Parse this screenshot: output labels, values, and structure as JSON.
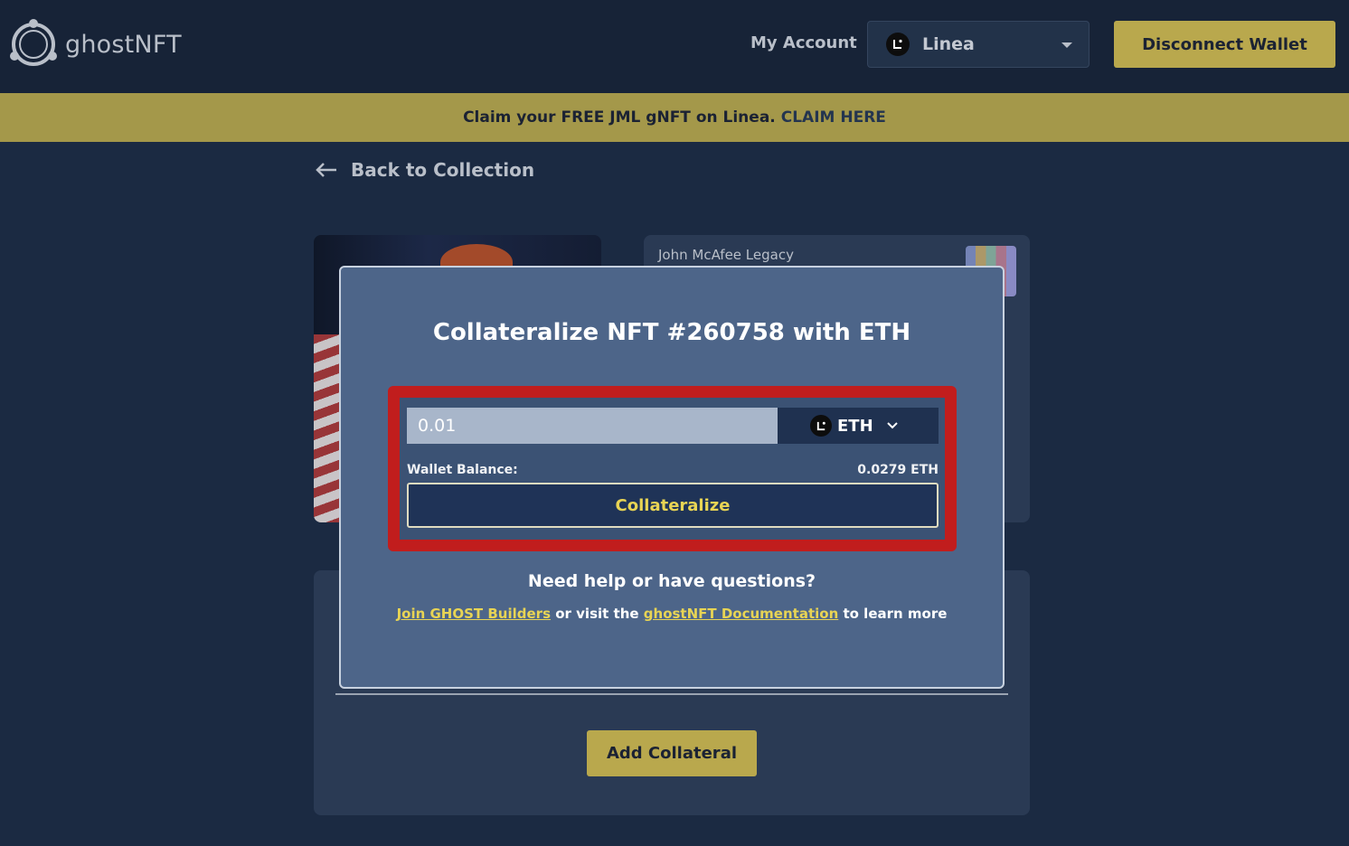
{
  "header": {
    "logo_text": "ghostNFT",
    "my_account_label": "My Account",
    "network": {
      "label": "Linea",
      "icon": "linea-icon"
    },
    "disconnect_label": "Disconnect Wallet"
  },
  "banner": {
    "text": "Claim your FREE JML gNFT on Linea.",
    "link_label": "CLAIM HERE"
  },
  "back_link": {
    "label": "Back to Collection",
    "icon": "arrow-left-icon"
  },
  "info_card": {
    "collection_name": "John McAfee Legacy"
  },
  "lower_card": {
    "add_collateral_label": "Add Collateral"
  },
  "modal": {
    "title": "Collateralize NFT #260758 with ETH",
    "amount_value": "0.01",
    "token": {
      "label": "ETH",
      "icon": "linea-icon"
    },
    "wallet_balance_label": "Wallet Balance:",
    "wallet_balance_value": "0.0279 ETH",
    "collateralize_label": "Collateralize",
    "help_title": "Need help or have questions?",
    "help_link_1": "Join GHOST Builders",
    "help_text_1": " or visit the ",
    "help_link_2": "ghostNFT Documentation",
    "help_text_2": " to learn more"
  },
  "colors": {
    "background": "#1b2a42",
    "accent_gold": "#b9a84d",
    "highlight_red": "#c11d1d",
    "link_yellow": "#e8d454"
  }
}
